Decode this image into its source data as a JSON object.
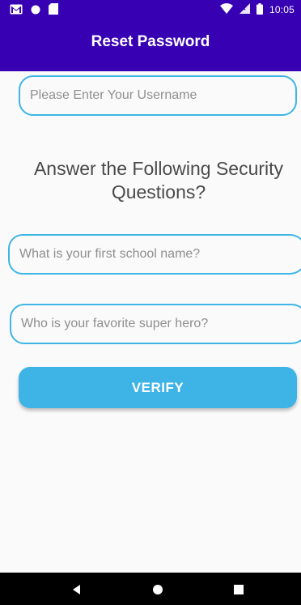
{
  "status_bar": {
    "time": "10:05",
    "icons": [
      "gmail-icon",
      "circle-notification-icon",
      "sd-card-icon",
      "wifi-icon",
      "signal-icon",
      "battery-icon"
    ]
  },
  "app_bar": {
    "title": "Reset Password"
  },
  "form": {
    "username_placeholder": "Please Enter Your Username",
    "heading": "Answer the Following Security Questions?",
    "question1_placeholder": "What is your first school name?",
    "question2_placeholder": "Who is your favorite super hero?",
    "verify_label": "VERIFY"
  },
  "nav_bar": {
    "icons": [
      "back-icon",
      "home-icon",
      "recent-apps-icon"
    ]
  },
  "colors": {
    "app_bar": "#3700b3",
    "accent": "#3db3e6",
    "border": "#3fb5e5",
    "background": "#fafafa"
  }
}
